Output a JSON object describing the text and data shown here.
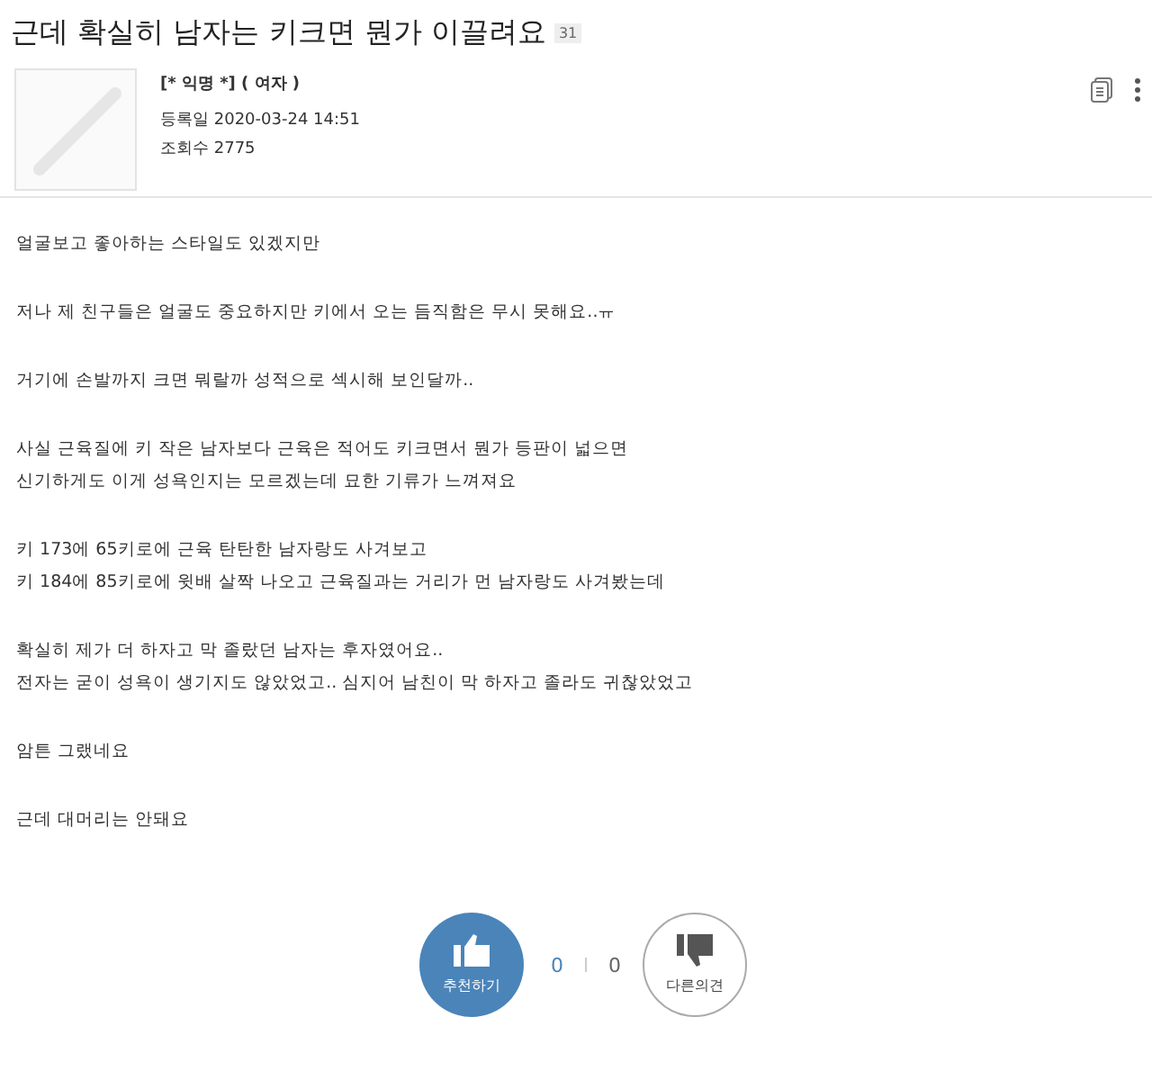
{
  "post": {
    "title": "근데 확실히 남자는 키크면 뭔가 이끌려요",
    "comment_count": "31"
  },
  "author": {
    "name": "[* 익명 *] ( 여자 )",
    "date_label": "등록일",
    "date": "2020-03-24 14:51",
    "views_label": "조회수",
    "views": "2775"
  },
  "paragraphs": [
    [
      "얼굴보고 좋아하는 스타일도 있겠지만"
    ],
    [
      "저나 제 친구들은 얼굴도 중요하지만 키에서 오는 듬직함은 무시 못해요..ㅠ"
    ],
    [
      "거기에 손발까지 크면 뭐랄까 성적으로 섹시해 보인달까.."
    ],
    [
      "사실 근육질에 키 작은 남자보다 근육은 적어도 키크면서 뭔가 등판이 넓으면",
      "신기하게도 이게 성욕인지는 모르겠는데 묘한 기류가 느껴져요"
    ],
    [
      "키 173에 65키로에 근육 탄탄한 남자랑도 사겨보고",
      "키 184에 85키로에 윗배 살짝 나오고 근육질과는 거리가 먼 남자랑도 사겨봤는데"
    ],
    [
      "확실히 제가 더 하자고 막 졸랐던 남자는 후자였어요..",
      "전자는 굳이 성욕이 생기지도 않았었고.. 심지어 남친이 막 하자고 졸라도 귀찮았었고"
    ],
    [
      "암튼 그랬네요"
    ],
    [
      "근데 대머리는 안돼요"
    ]
  ],
  "votes": {
    "up_label": "추천하기",
    "up_count": "0",
    "down_count": "0",
    "down_label": "다른의견"
  }
}
